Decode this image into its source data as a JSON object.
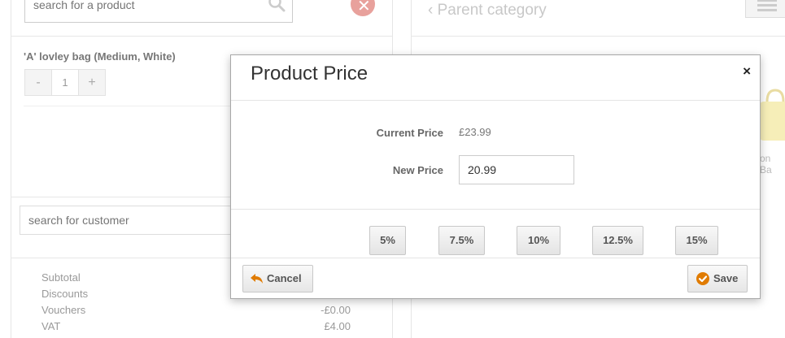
{
  "background": {
    "product_search": {
      "placeholder": "search for a product"
    },
    "cart_item": {
      "name": "'A' lovley bag (Medium, White)",
      "qty": "1",
      "minus": "-",
      "plus": "+"
    },
    "customer_search": {
      "placeholder": "search for customer"
    },
    "totals": [
      {
        "label": "Subtotal",
        "value": ""
      },
      {
        "label": "Discounts",
        "value": ""
      },
      {
        "label": "Vouchers",
        "value": "-£0.00"
      },
      {
        "label": "VAT",
        "value": "£4.00"
      }
    ],
    "category": {
      "back_label": "Parent category"
    },
    "product_tile": {
      "label_fragment": "on Ba"
    }
  },
  "modal": {
    "title": "Product Price",
    "close_glyph": "×",
    "current_price_label": "Current Price",
    "current_price_value": "£23.99",
    "new_price_label": "New Price",
    "new_price_value": "20.99",
    "discount_buttons": [
      "5%",
      "7.5%",
      "10%",
      "12.5%",
      "15%"
    ],
    "cancel_label": "Cancel",
    "save_label": "Save"
  },
  "colors": {
    "accent_orange": "#e07b00",
    "clear_icon": "#e8a19c"
  }
}
